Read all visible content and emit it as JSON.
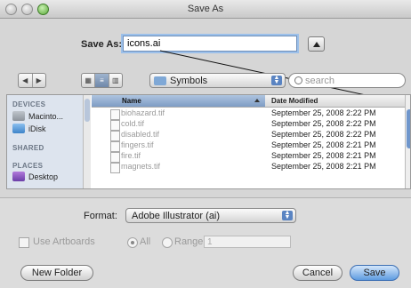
{
  "window": {
    "title": "Save As"
  },
  "save_as": {
    "label": "Save As:",
    "value": "icons.ai"
  },
  "toolbar": {
    "location": "Symbols",
    "search_placeholder": "search"
  },
  "sidebar": {
    "sections": [
      {
        "title": "DEVICES",
        "items": [
          "Macinto...",
          "iDisk"
        ]
      },
      {
        "title": "SHARED",
        "items": []
      },
      {
        "title": "PLACES",
        "items": [
          "Desktop"
        ]
      }
    ]
  },
  "file_list": {
    "columns": [
      "Name",
      "Date Modified"
    ],
    "rows": [
      {
        "name": "biohazard.tif",
        "date": "September 25, 2008 2:22 PM"
      },
      {
        "name": "cold.tif",
        "date": "September 25, 2008 2:22 PM"
      },
      {
        "name": "disabled.tif",
        "date": "September 25, 2008 2:22 PM"
      },
      {
        "name": "fingers.tif",
        "date": "September 25, 2008 2:21 PM"
      },
      {
        "name": "fire.tif",
        "date": "September 25, 2008 2:21 PM"
      },
      {
        "name": "magnets.tif",
        "date": "September 25, 2008 2:21 PM"
      }
    ]
  },
  "format": {
    "label": "Format:",
    "value": "Adobe Illustrator (ai)"
  },
  "options": {
    "use_artboards": "Use Artboards",
    "all": "All",
    "range": "Range:",
    "range_value": "1"
  },
  "buttons": {
    "new_folder": "New Folder",
    "cancel": "Cancel",
    "save": "Save"
  }
}
